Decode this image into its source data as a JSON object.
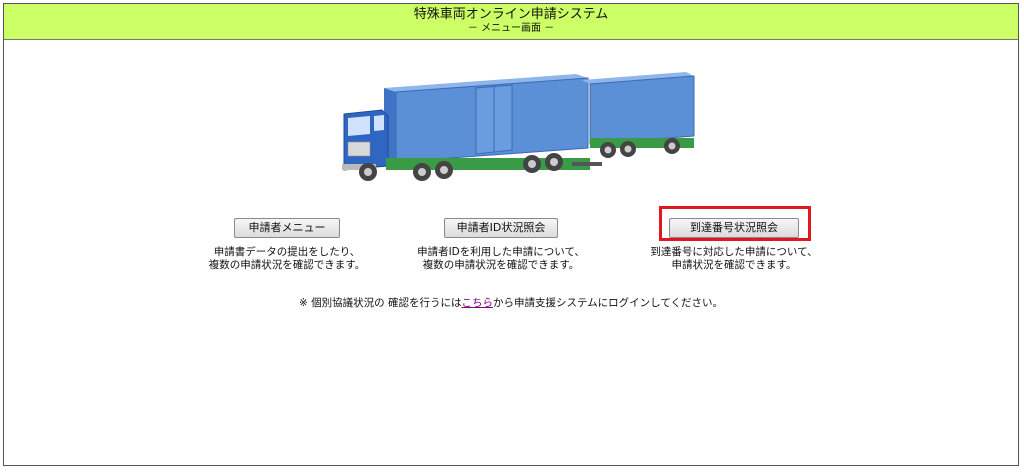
{
  "header": {
    "title": "特殊車両オンライン申請システム",
    "subtitle": "－ メニュー画面 －"
  },
  "image": {
    "icon": "truck-illustration",
    "colors": {
      "body": "#5b8fd6",
      "cab": "#2f66c2",
      "chassis": "#3a9b47",
      "wheel": "#444444"
    }
  },
  "menu": [
    {
      "button_label": "申請者メニュー",
      "description_line1": "申請書データの提出をしたり、",
      "description_line2": "複数の申請状況を確認できます。"
    },
    {
      "button_label": "申請者ID状況照会",
      "description_line1": "申請者IDを利用した申請について、",
      "description_line2": "複数の申請状況を確認できます。"
    },
    {
      "button_label": "到達番号状況照会",
      "description_line1": "到達番号に対応した申請について、",
      "description_line2": "申請状況を確認できます。"
    }
  ],
  "note": {
    "prefix": "※ 個別協議状況の 確認を行うには",
    "link_text": "こちら",
    "suffix": "から申請支援システムにログインしてください。"
  },
  "colors": {
    "header_bg": "#ccff66",
    "highlight": "#e0191e",
    "link": "#800080"
  }
}
